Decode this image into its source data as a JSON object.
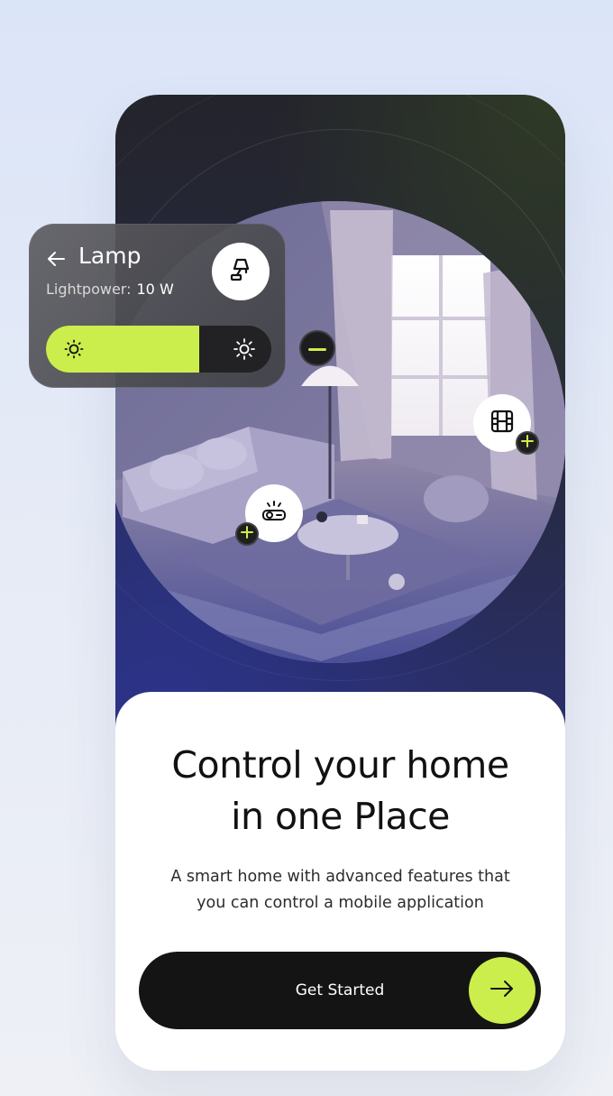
{
  "lamp_card": {
    "title": "Lamp",
    "lightpower_label": "Lightpower:",
    "lightpower_value": "10 W",
    "brightness_fraction": 0.68,
    "icons": {
      "back": "arrow-left-icon",
      "device": "lamp-icon",
      "low": "sun-low-icon",
      "high": "sun-high-icon"
    }
  },
  "hero": {
    "devices": [
      {
        "icon": "projector-icon",
        "action": "add"
      },
      {
        "icon": "film-icon",
        "action": "add"
      }
    ],
    "remove_icon": "minus-icon"
  },
  "onboarding": {
    "title_line1": "Control your home",
    "title_line2": "in one Place",
    "subtitle_line1": "A smart home with advanced features that",
    "subtitle_line2": "you can control a mobile application",
    "cta_label": "Get Started",
    "cta_icon": "arrow-right-icon"
  },
  "colors": {
    "accent": "#ccee4c",
    "dark": "#141414",
    "card_bg": "#ffffff"
  }
}
